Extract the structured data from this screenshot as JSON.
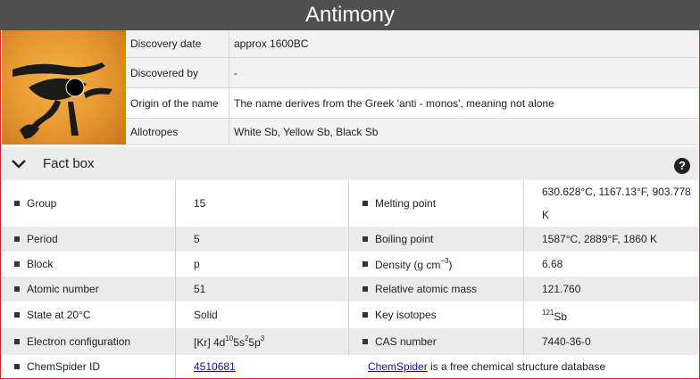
{
  "element_name": "Antimony",
  "image_icon": "eye-of-horus-icon",
  "info": [
    {
      "key": "Discovery date",
      "value": "approx 1600BC"
    },
    {
      "key": "Discovered by",
      "value": "-"
    },
    {
      "key": "Origin of the name",
      "value": "The name derives from the Greek 'anti - monos', meaning not alone"
    },
    {
      "key": "Allotropes",
      "value": "White Sb, Yellow Sb, Black Sb"
    }
  ],
  "factbox": {
    "label": "Fact box",
    "collapse_icon": "chevron-down-icon",
    "help_icon": "help-icon",
    "help_glyph": "?"
  },
  "facts": {
    "group": {
      "label": "Group",
      "value": "15"
    },
    "melting": {
      "label": "Melting point",
      "value": "630.628°C, 1167.13°F, 903.778 K"
    },
    "period": {
      "label": "Period",
      "value": "5"
    },
    "boiling": {
      "label": "Boiling point",
      "value": "1587°C, 2889°F, 1860 K"
    },
    "block": {
      "label": "Block",
      "value": "p"
    },
    "density": {
      "label_main": "Density (g cm",
      "label_sup": "−3",
      "label_close": ")",
      "value": "6.68"
    },
    "atomic_number": {
      "label": "Atomic number",
      "value": "51"
    },
    "ram": {
      "label": "Relative atomic mass",
      "value": "121.760"
    },
    "state": {
      "label": "State at 20°C",
      "value": "Solid"
    },
    "isotopes": {
      "label": "Key isotopes",
      "mass": "121",
      "symbol": "Sb"
    },
    "config": {
      "label": "Electron configuration",
      "p1": "[Kr] 4d",
      "s1": "10",
      "p2": "5s",
      "s2": "2",
      "p3": "5p",
      "s3": "3"
    },
    "cas": {
      "label": "CAS number",
      "value": "7440-36-0"
    },
    "chemspider": {
      "label": "ChemSpider ID",
      "value": "4510681",
      "link_text": "ChemSpider",
      "desc": " is a free chemical structure database"
    }
  }
}
